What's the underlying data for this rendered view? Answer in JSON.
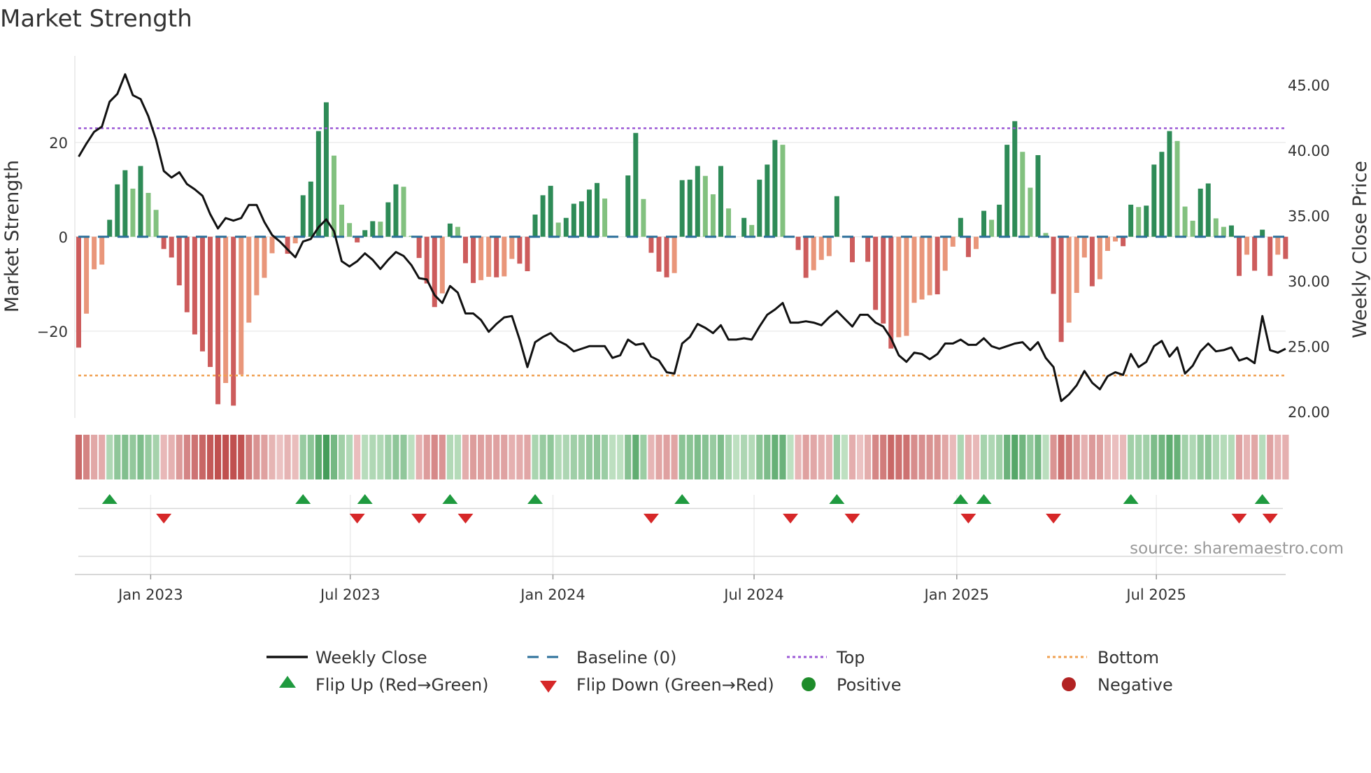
{
  "chart_data": {
    "type": "bar",
    "title": "Market Strength",
    "ylabel": "Market Strength",
    "y2label": "Weekly Close Price",
    "ylim": [
      -38,
      38
    ],
    "y2lim": [
      18.5,
      47.5
    ],
    "yticks": [
      20,
      0,
      -20
    ],
    "ytick_labels": [
      "20",
      "0",
      "−20"
    ],
    "y2ticks": [
      45,
      40,
      35,
      30,
      25,
      20
    ],
    "y2tick_labels": [
      "45.00",
      "40.00",
      "35.00",
      "30.00",
      "25.00",
      "20.00"
    ],
    "xtick_weeks": [
      9.3,
      35.1,
      61.3,
      87.3,
      113.5,
      139.3
    ],
    "xtick_labels": [
      "Jan 2023",
      "Jul 2023",
      "Jan 2024",
      "Jul 2024",
      "Jan 2025",
      "Jul 2025"
    ],
    "top_level": 23,
    "bottom_level": -29.4,
    "strength": [
      -23.5,
      -16.3,
      -6.9,
      -5.9,
      3.6,
      11.1,
      14.1,
      10.2,
      15,
      9.3,
      5.7,
      -2.6,
      -4.4,
      -10.3,
      -16,
      -20.7,
      -24.3,
      -27.6,
      -35.5,
      -31,
      -35.8,
      -29.2,
      -18.2,
      -12.4,
      -8.7,
      -3.5,
      0,
      -3.6,
      -1.4,
      8.8,
      11.7,
      22.4,
      28.5,
      17.2,
      6.8,
      2.9,
      -1.2,
      1.4,
      3.3,
      3.2,
      7.3,
      11.1,
      10.6,
      0.2,
      -4.5,
      -9.9,
      -14.9,
      -12,
      2.8,
      2.1,
      -5.6,
      -9.8,
      -9.2,
      -8.5,
      -8.6,
      -8.4,
      -4.7,
      -5.7,
      -7.3,
      4.7,
      8.8,
      10.8,
      3,
      4,
      7,
      7.5,
      10,
      11.4,
      8.1,
      0.2,
      0,
      13,
      22,
      8,
      -3.4,
      -7.4,
      -8.6,
      -7.7,
      12,
      12.1,
      15,
      12.9,
      9,
      15,
      6,
      0,
      4,
      2.5,
      12.1,
      15.3,
      20.5,
      19.5,
      0,
      -2.8,
      -8.7,
      -7.1,
      -4.9,
      -4.1,
      8.6,
      0,
      -5.4,
      0,
      -5.3,
      -15.5,
      -18.4,
      -23.7,
      -21.3,
      -21,
      -14,
      -13.3,
      -12.4,
      -12.2,
      -7.2,
      -2.1,
      4,
      -4.3,
      -2.6,
      5.5,
      3.6,
      6.8,
      19.5,
      24.5,
      18,
      10.4,
      17.3,
      0.8,
      -12.1,
      -22.3,
      -18.2,
      -11.9,
      -4.4,
      -10.5,
      -9,
      -3,
      -1,
      -2,
      6.8,
      6.3,
      6.6,
      15.3,
      18,
      22.4,
      20.3,
      6.4,
      3.4,
      10.2,
      11.3,
      3.9,
      2.1,
      2.4,
      -8.3,
      -3.8,
      -7.2,
      1.5,
      -8.3,
      -3.8,
      -4.7
    ],
    "shade": "RSSSDDDLDLLRRRRRRRRSRSSSSSZRSDDDDLLLRDDLDDLLRRRSDLRRSSRSSRRDDDLDDDDDLLZDDLRRRSDDDLLDLZDLDDDLZRRSSSDZRZRRRRSSSSSRSSDRSDLDDDLLDLRRSSSRSSSRDLDDDDLLLDDLLDRSRDRSR",
    "weekly_close": [
      39.5,
      40.5,
      41.4,
      41.8,
      43.7,
      44.3,
      45.8,
      44.2,
      43.9,
      42.6,
      40.8,
      38.4,
      37.9,
      38.3,
      37.4,
      37.0,
      36.5,
      35.1,
      34.0,
      34.8,
      34.6,
      34.8,
      35.8,
      35.8,
      34.5,
      33.5,
      33.0,
      32.4,
      31.8,
      33.0,
      33.2,
      34.1,
      34.7,
      33.8,
      31.5,
      31.1,
      31.5,
      32.1,
      31.6,
      30.9,
      31.6,
      32.2,
      31.9,
      31.2,
      30.2,
      30.1,
      28.9,
      28.3,
      29.6,
      29.1,
      27.5,
      27.5,
      27.0,
      26.1,
      26.7,
      27.2,
      27.3,
      25.5,
      23.4,
      25.3,
      25.7,
      26.0,
      25.4,
      25.1,
      24.6,
      24.8,
      25.0,
      25.0,
      25.0,
      24.1,
      24.3,
      25.5,
      25.1,
      25.2,
      24.2,
      23.9,
      23.0,
      22.9,
      25.2,
      25.7,
      26.7,
      26.4,
      26.0,
      26.6,
      25.5,
      25.5,
      25.6,
      25.5,
      26.5,
      27.4,
      27.8,
      28.3,
      26.8,
      26.8,
      26.9,
      26.8,
      26.6,
      27.2,
      27.7,
      27.1,
      26.5,
      27.4,
      27.4,
      26.8,
      26.5,
      25.6,
      24.3,
      23.8,
      24.5,
      24.4,
      24.0,
      24.4,
      25.2,
      25.2,
      25.5,
      25.1,
      25.1,
      25.6,
      25.0,
      24.8,
      25.0,
      25.2,
      25.3,
      24.7,
      25.3,
      24.1,
      23.4,
      20.8,
      21.3,
      22.0,
      23.1,
      22.2,
      21.7,
      22.7,
      23.0,
      22.8,
      24.4,
      23.4,
      23.8,
      25.0,
      25.4,
      24.2,
      24.9,
      22.9,
      23.5,
      24.6,
      25.2,
      24.6,
      24.7,
      24.9,
      23.9,
      24.1,
      23.7,
      27.3,
      24.7,
      24.5,
      24.8
    ],
    "flip_up_weeks": [
      4,
      29,
      37,
      48,
      59,
      78,
      98,
      114,
      117,
      136,
      153
    ],
    "flip_down_weeks": [
      11,
      36,
      44,
      50,
      74,
      92,
      100,
      115,
      126,
      150,
      154
    ],
    "legend": {
      "weekly_close": "Weekly Close",
      "baseline": "Baseline (0)",
      "top": "Top",
      "bottom": "Bottom",
      "flip_up": "Flip Up (Red→Green)",
      "flip_down": "Flip Down (Green→Red)",
      "positive": "Positive",
      "negative": "Negative"
    },
    "legend_placement": "bottom-center",
    "source": "source: sharemaestro.com",
    "colors": {
      "pos_strong": "#2e8b57",
      "pos_weak": "#82c17f",
      "neg_strong": "#cd5c5c",
      "neg_weak": "#e9967a",
      "line": "#111111",
      "baseline": "#2b6f9a",
      "top": "#9b59d6",
      "bottom": "#f0a050",
      "flip_up": "#1f9a3f",
      "flip_down": "#d62728",
      "positive": "#1e8c2a",
      "negative": "#b22222"
    }
  }
}
